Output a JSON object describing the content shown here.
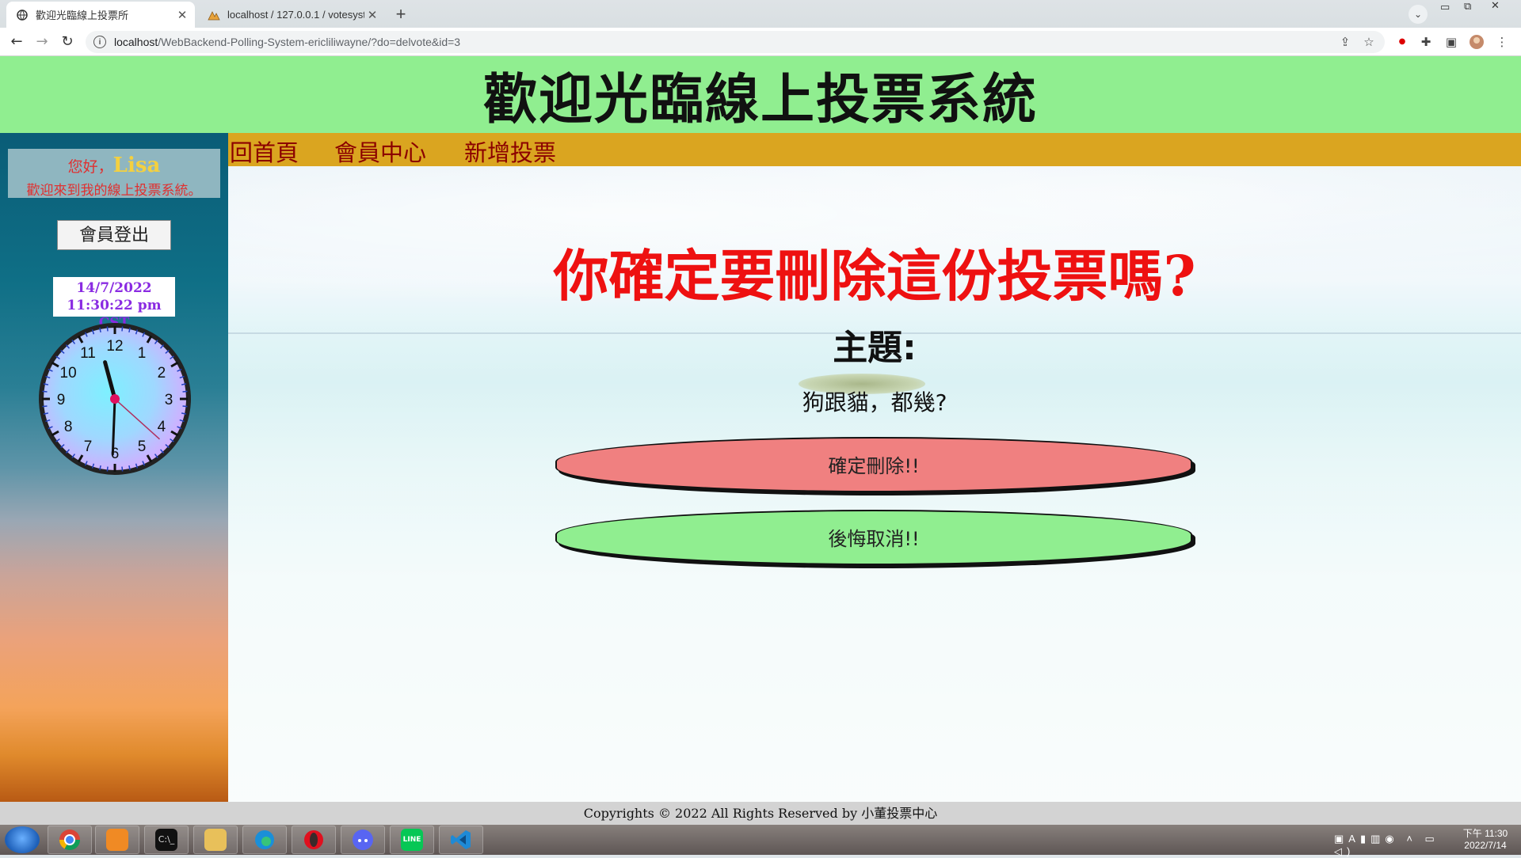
{
  "browser": {
    "tabs": [
      {
        "title": "歡迎光臨線上投票所",
        "active": true
      },
      {
        "title": "localhost / 127.0.0.1 / votesyst",
        "active": false
      }
    ],
    "url_host": "localhost",
    "url_path": "/WebBackend-Polling-System-ericliliwayne/?do=delvote&id=3"
  },
  "header": {
    "title": "歡迎光臨線上投票系統"
  },
  "sidebar": {
    "greeting_prefix": "您好，",
    "username": "Lisa",
    "welcome": "歡迎來到我的線上投票系統。",
    "logout_label": "會員登出",
    "date": "14/7/2022",
    "time": "11:30:22 pm CST",
    "clock": {
      "hour": 11,
      "minute": 30,
      "second": 22
    }
  },
  "menu": {
    "home": "回首頁",
    "member_center": "會員中心",
    "add_vote": "新增投票"
  },
  "main": {
    "confirm_title": "你確定要刪除這份投票嗎",
    "confirm_q": "?",
    "subject_label": "主題:",
    "subject_value": "狗跟貓，都幾?",
    "delete_button": "確定刪除!!",
    "cancel_button": "後悔取消!!"
  },
  "footer": {
    "text": "Copyrights © 2022 All Rights Reserved by 小董投票中心"
  },
  "taskbar": {
    "time": "下午 11:30",
    "date": "2022/7/14"
  },
  "colors": {
    "header_bg": "#90ee90",
    "menu_bg": "#daa520",
    "menu_text": "#8b0000",
    "title_red": "#ee1111",
    "delete_btn": "#f08080",
    "cancel_btn": "#90ee90"
  }
}
